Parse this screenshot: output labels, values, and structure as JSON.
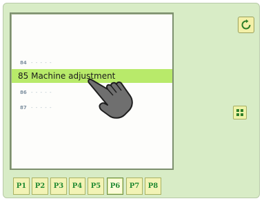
{
  "list": {
    "items": [
      {
        "num": "84",
        "text": "- - - - -"
      },
      {
        "num": "85",
        "text": "85 Machine adjustment",
        "selected": true
      },
      {
        "num": "86",
        "text": "- - - - -"
      },
      {
        "num": "87",
        "text": "- - - - -"
      }
    ]
  },
  "tabs": [
    "P1",
    "P2",
    "P3",
    "P4",
    "P5",
    "P6",
    "P7",
    "P8"
  ],
  "active_tab": "P6",
  "icons": {
    "scroll": "refresh-icon",
    "side": "table-icon",
    "cursor": "hand-pointer-icon"
  },
  "colors": {
    "background": "#d8ecc6",
    "selected_row": "#b8ea6a",
    "tab_text": "#228a33"
  }
}
